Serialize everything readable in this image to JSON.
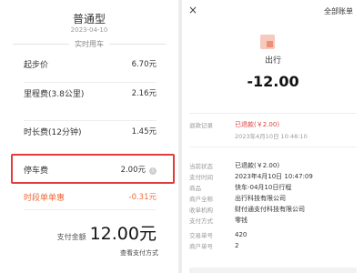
{
  "left": {
    "title": "普通型",
    "date": "2023-04-10",
    "section_label": "实时用车",
    "start_price": {
      "label": "起步价",
      "value": "6.70元"
    },
    "mileage": {
      "label": "里程费(3.8公里)",
      "value": "2.16元"
    },
    "duration": {
      "label": "时长费(12分钟)",
      "value": "1.45元"
    },
    "parking": {
      "label": "停车费",
      "value": "2.00元",
      "info_icon": "i"
    },
    "discount": {
      "label": "时段单单惠",
      "value": "-0.31元"
    },
    "total": {
      "label": "支付金额",
      "amount": "12.00元"
    },
    "detail_link": "查看支付方式"
  },
  "right": {
    "close_icon": "×",
    "all_bills": "全部账单",
    "merchant": "出行",
    "amount": "-12.00",
    "refund_record": {
      "label": "退款记录",
      "value": "已退款(￥2.00)"
    },
    "refund_time": "2023年4月10日 10:48:10",
    "details": [
      {
        "label": "当前状态",
        "value": "已退款(￥2.00)"
      },
      {
        "label": "支付时间",
        "value": "2023年4月10日 10:47:09"
      },
      {
        "label": "商品",
        "value": "快车-04月10日行程"
      },
      {
        "label": "商户全称",
        "value": "出行科技有限公司"
      },
      {
        "label": "收单机构",
        "value": "财付通支付科技有限公司"
      },
      {
        "label": "支付方式",
        "value": "零钱"
      },
      {
        "label": "交易单号",
        "value": "420"
      },
      {
        "label": "商户单号",
        "value": "2"
      }
    ]
  },
  "colors": {
    "highlight_border": "#e23d3d",
    "discount": "#f26b3a",
    "refund": "#e23d3d"
  }
}
